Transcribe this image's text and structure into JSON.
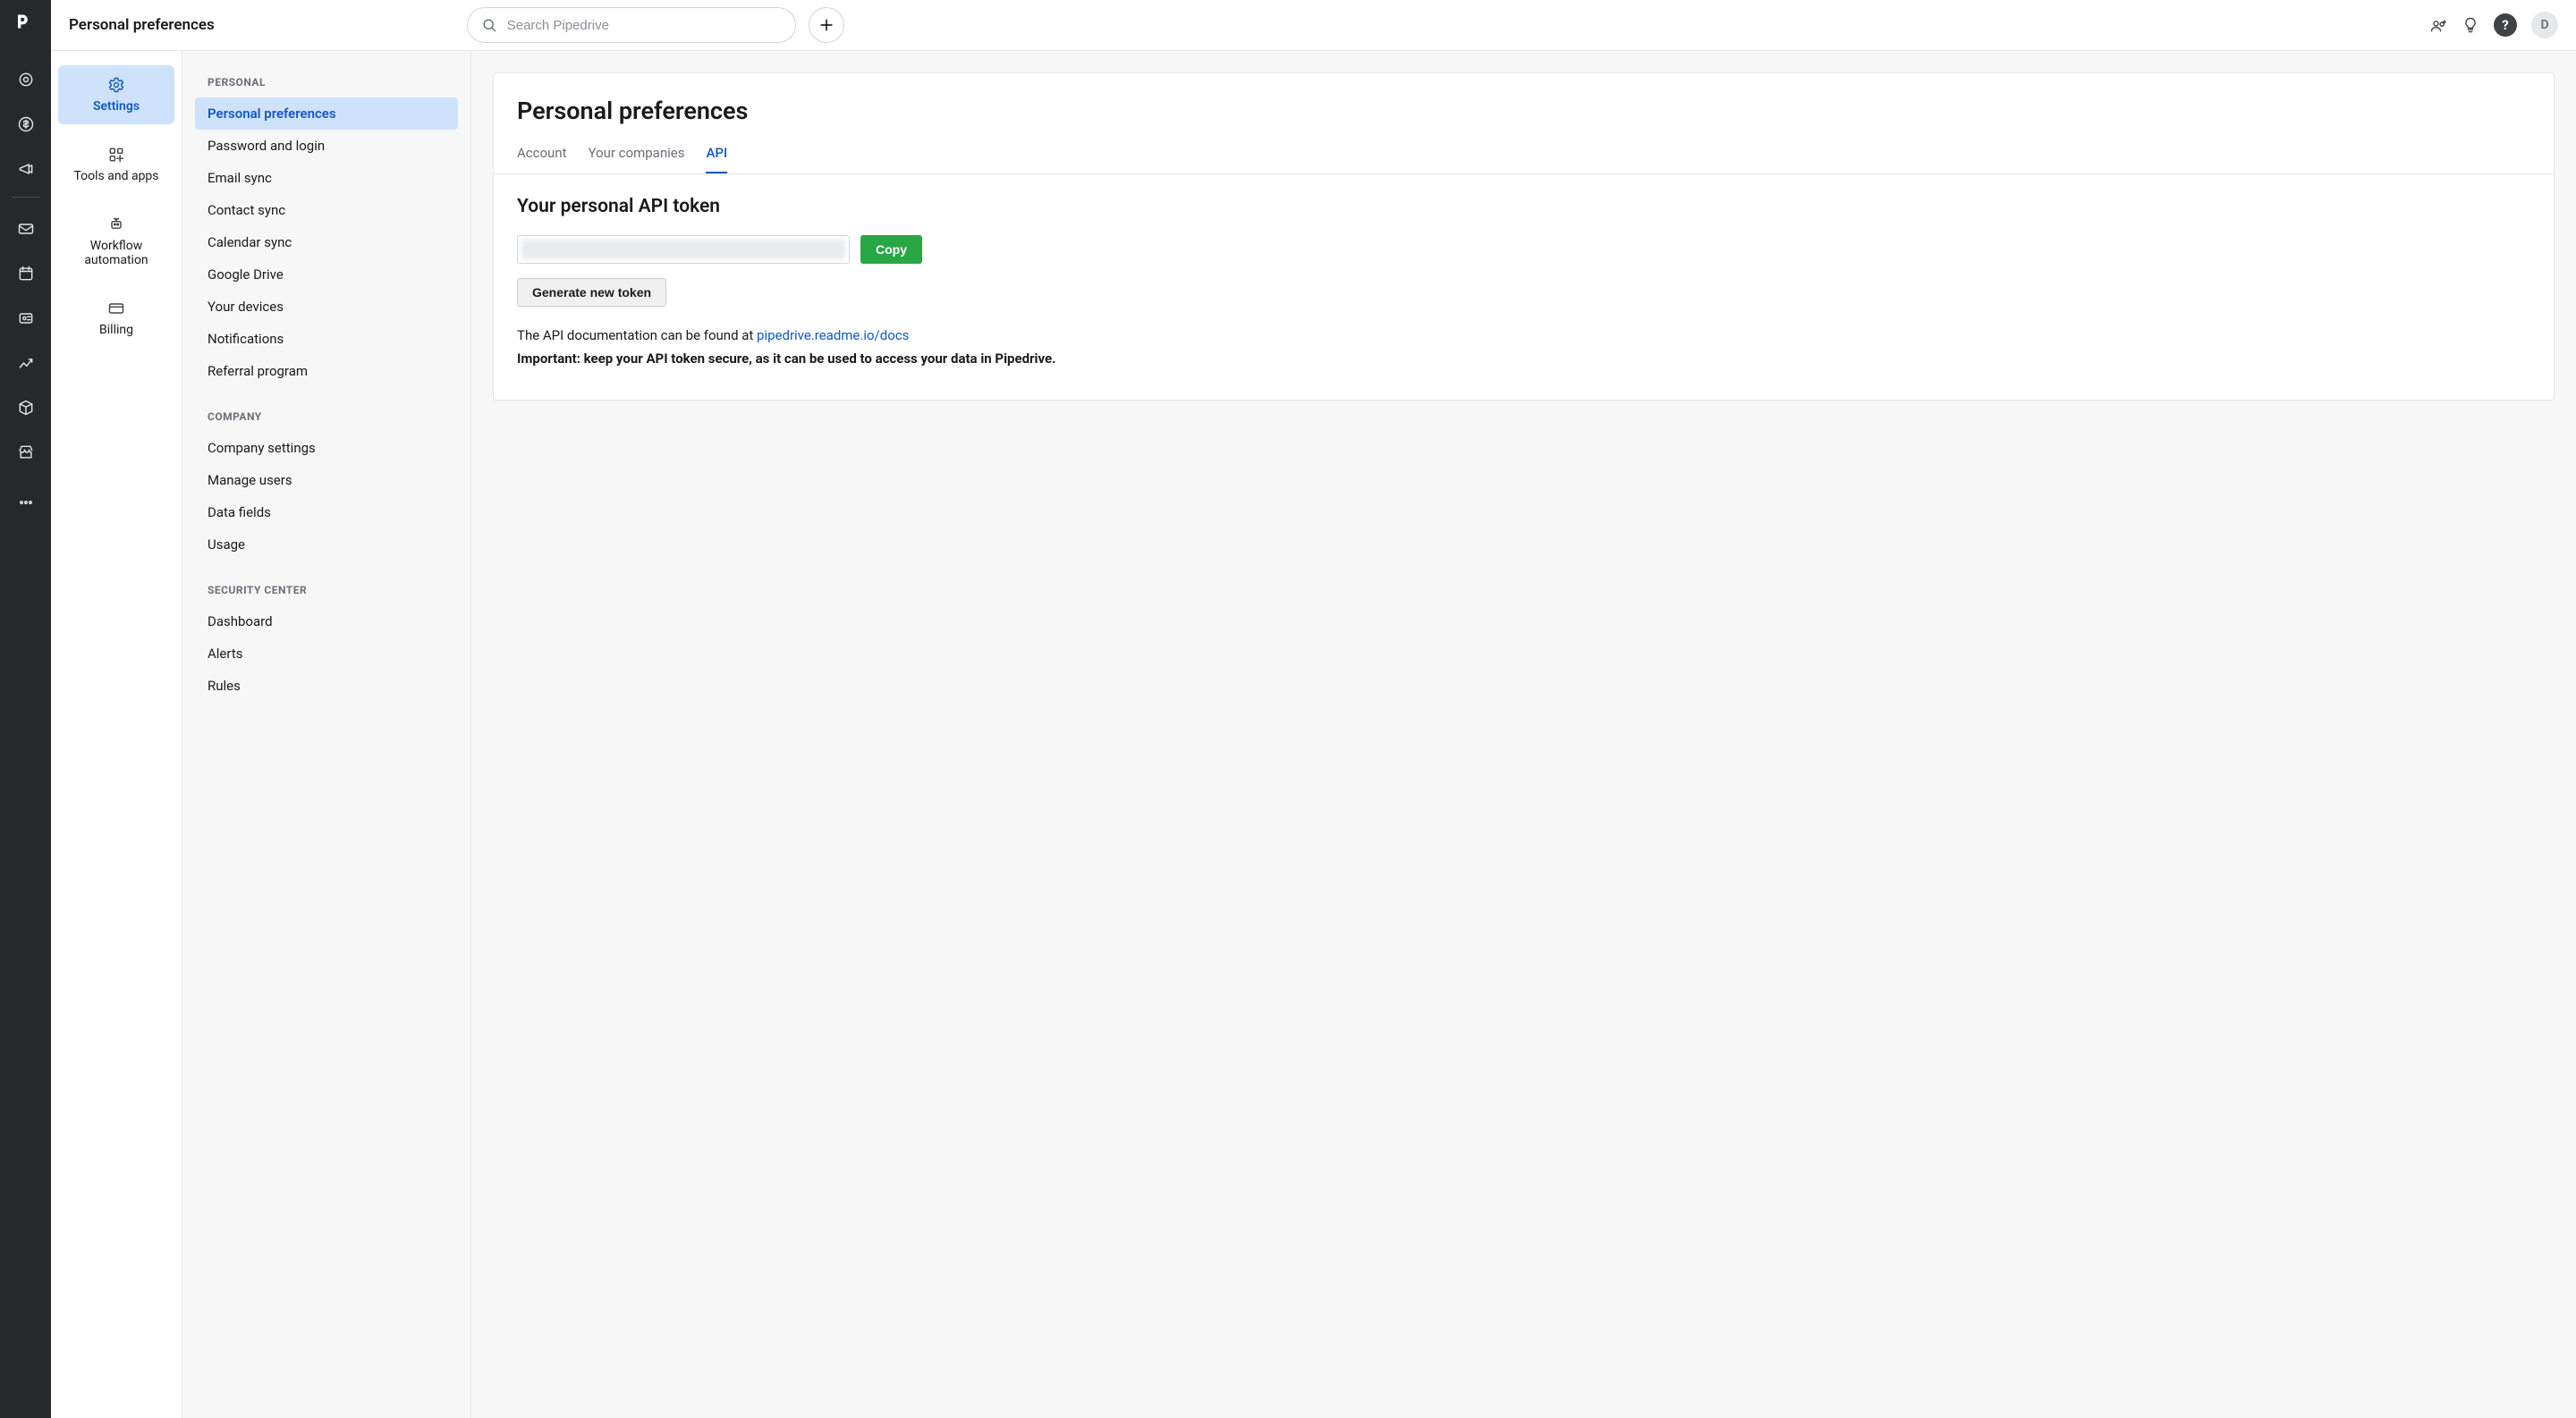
{
  "topbar": {
    "title": "Personal preferences",
    "search_placeholder": "Search Pipedrive",
    "avatar_initial": "D",
    "help_glyph": "?"
  },
  "widecol": {
    "settings": "Settings",
    "tools": "Tools and apps",
    "workflow": "Workflow automation",
    "billing": "Billing"
  },
  "settingsnav": {
    "personal_heading": "PERSONAL",
    "personal": [
      "Personal preferences",
      "Password and login",
      "Email sync",
      "Contact sync",
      "Calendar sync",
      "Google Drive",
      "Your devices",
      "Notifications",
      "Referral program"
    ],
    "company_heading": "COMPANY",
    "company": [
      "Company settings",
      "Manage users",
      "Data fields",
      "Usage"
    ],
    "security_heading": "SECURITY CENTER",
    "security": [
      "Dashboard",
      "Alerts",
      "Rules"
    ]
  },
  "content": {
    "page_heading": "Personal preferences",
    "tabs": [
      "Account",
      "Your companies",
      "API"
    ],
    "active_tab": "API",
    "section_heading": "Your personal API token",
    "copy_btn": "Copy",
    "generate_btn": "Generate new token",
    "doc_text_prefix": "The API documentation can be found at ",
    "doc_link_text": "pipedrive.readme.io/docs",
    "important_text": "Important: keep your API token secure, as it can be used to access your data in Pipedrive."
  }
}
